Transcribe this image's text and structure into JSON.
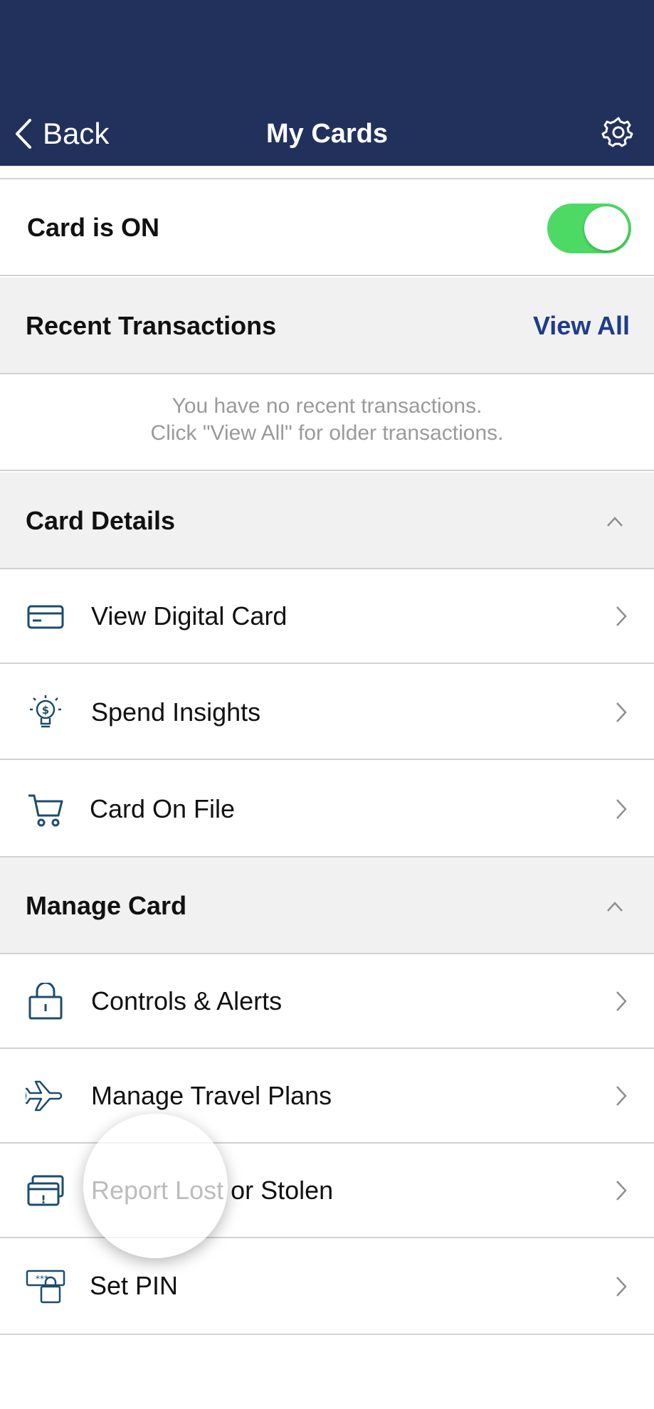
{
  "header": {
    "back_label": "Back",
    "title": "My Cards"
  },
  "card_toggle": {
    "label": "Card is ON",
    "state": "on",
    "on_color": "#4cd964"
  },
  "recent_transactions": {
    "title": "Recent Transactions",
    "view_all_label": "View All",
    "empty_line1": "You have no recent transactions.",
    "empty_line2": "Click \"View All\" for older transactions."
  },
  "card_details": {
    "title": "Card Details",
    "items": [
      {
        "label": "View Digital Card",
        "icon": "credit-card-icon"
      },
      {
        "label": "Spend Insights",
        "icon": "lightbulb-dollar-icon"
      },
      {
        "label": "Card On File",
        "icon": "shopping-cart-icon"
      }
    ]
  },
  "manage_card": {
    "title": "Manage Card",
    "items": [
      {
        "label": "Controls & Alerts",
        "icon": "lock-icon"
      },
      {
        "label": "Manage Travel Plans",
        "icon": "airplane-icon"
      },
      {
        "label": "Report Lost or Stolen",
        "icon": "card-alert-icon"
      },
      {
        "label": "Set PIN",
        "icon": "pin-lock-icon"
      }
    ]
  },
  "colors": {
    "header_bg": "#22315c",
    "accent": "#1f3c88",
    "icon": "#1b4d6b",
    "section_bg": "#f2f1f2"
  }
}
